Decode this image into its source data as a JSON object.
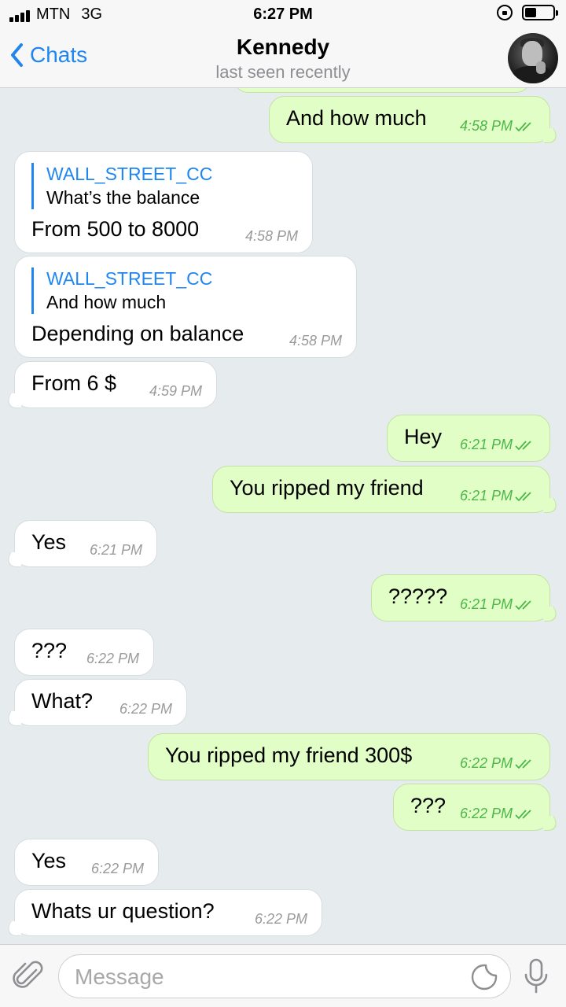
{
  "status_bar": {
    "carrier": "MTN",
    "network": "3G",
    "time": "6:27 PM"
  },
  "header": {
    "back_label": "Chats",
    "contact_name": "Kennedy",
    "status": "last seen recently"
  },
  "messages": [
    {
      "dir": "out",
      "text": "And how much",
      "time": "4:58 PM"
    },
    {
      "dir": "in",
      "reply_to": {
        "name": "WALL_STREET_CC",
        "text": "What’s the balance"
      },
      "text": "From 500 to 8000",
      "time": "4:58 PM"
    },
    {
      "dir": "in",
      "reply_to": {
        "name": "WALL_STREET_CC",
        "text": "And how much"
      },
      "text": "Depending on balance",
      "time": "4:58 PM"
    },
    {
      "dir": "in",
      "text": "From 6 $",
      "time": "4:59 PM"
    },
    {
      "dir": "out",
      "text": "Hey",
      "time": "6:21 PM"
    },
    {
      "dir": "out",
      "text": "You ripped my friend",
      "time": "6:21 PM"
    },
    {
      "dir": "in",
      "text": "Yes",
      "time": "6:21 PM"
    },
    {
      "dir": "out",
      "text": "?????",
      "time": "6:21 PM"
    },
    {
      "dir": "in",
      "text": "???",
      "time": "6:22 PM"
    },
    {
      "dir": "in",
      "text": "What?",
      "time": "6:22 PM"
    },
    {
      "dir": "out",
      "text": "You ripped my friend 300$",
      "time": "6:22 PM"
    },
    {
      "dir": "out",
      "text": "???",
      "time": "6:22 PM"
    },
    {
      "dir": "in",
      "text": "Yes",
      "time": "6:22 PM"
    },
    {
      "dir": "in",
      "text": "Whats ur question?",
      "time": "6:22 PM"
    }
  ],
  "input": {
    "placeholder": "Message"
  },
  "colors": {
    "accent": "#1f86f0",
    "outgoing_bubble": "#e1fec6",
    "incoming_bubble": "#ffffff",
    "read_check": "#4cb748",
    "background": "#e6ebee"
  }
}
